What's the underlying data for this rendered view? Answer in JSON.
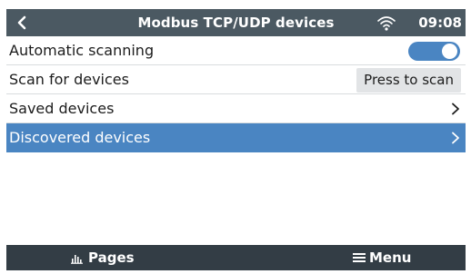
{
  "header": {
    "title": "Modbus TCP/UDP devices",
    "time": "09:08",
    "icons": [
      "back-chevron-icon",
      "wifi-icon"
    ]
  },
  "rows": [
    {
      "label": "Automatic scanning",
      "control": "toggle",
      "toggle_on": true
    },
    {
      "label": "Scan for devices",
      "control": "button",
      "button_label": "Press to scan"
    },
    {
      "label": "Saved devices",
      "control": "chevron"
    },
    {
      "label": "Discovered devices",
      "control": "chevron",
      "selected": true
    }
  ],
  "footer": {
    "pages_label": "Pages",
    "menu_label": "Menu",
    "icons": [
      "bar-chart-icon",
      "hamburger-icon"
    ]
  },
  "colors": {
    "header_bg": "#4b5962",
    "footer_bg": "#333d45",
    "accent": "#4a85c2",
    "button_bg": "#e2e4e6"
  }
}
